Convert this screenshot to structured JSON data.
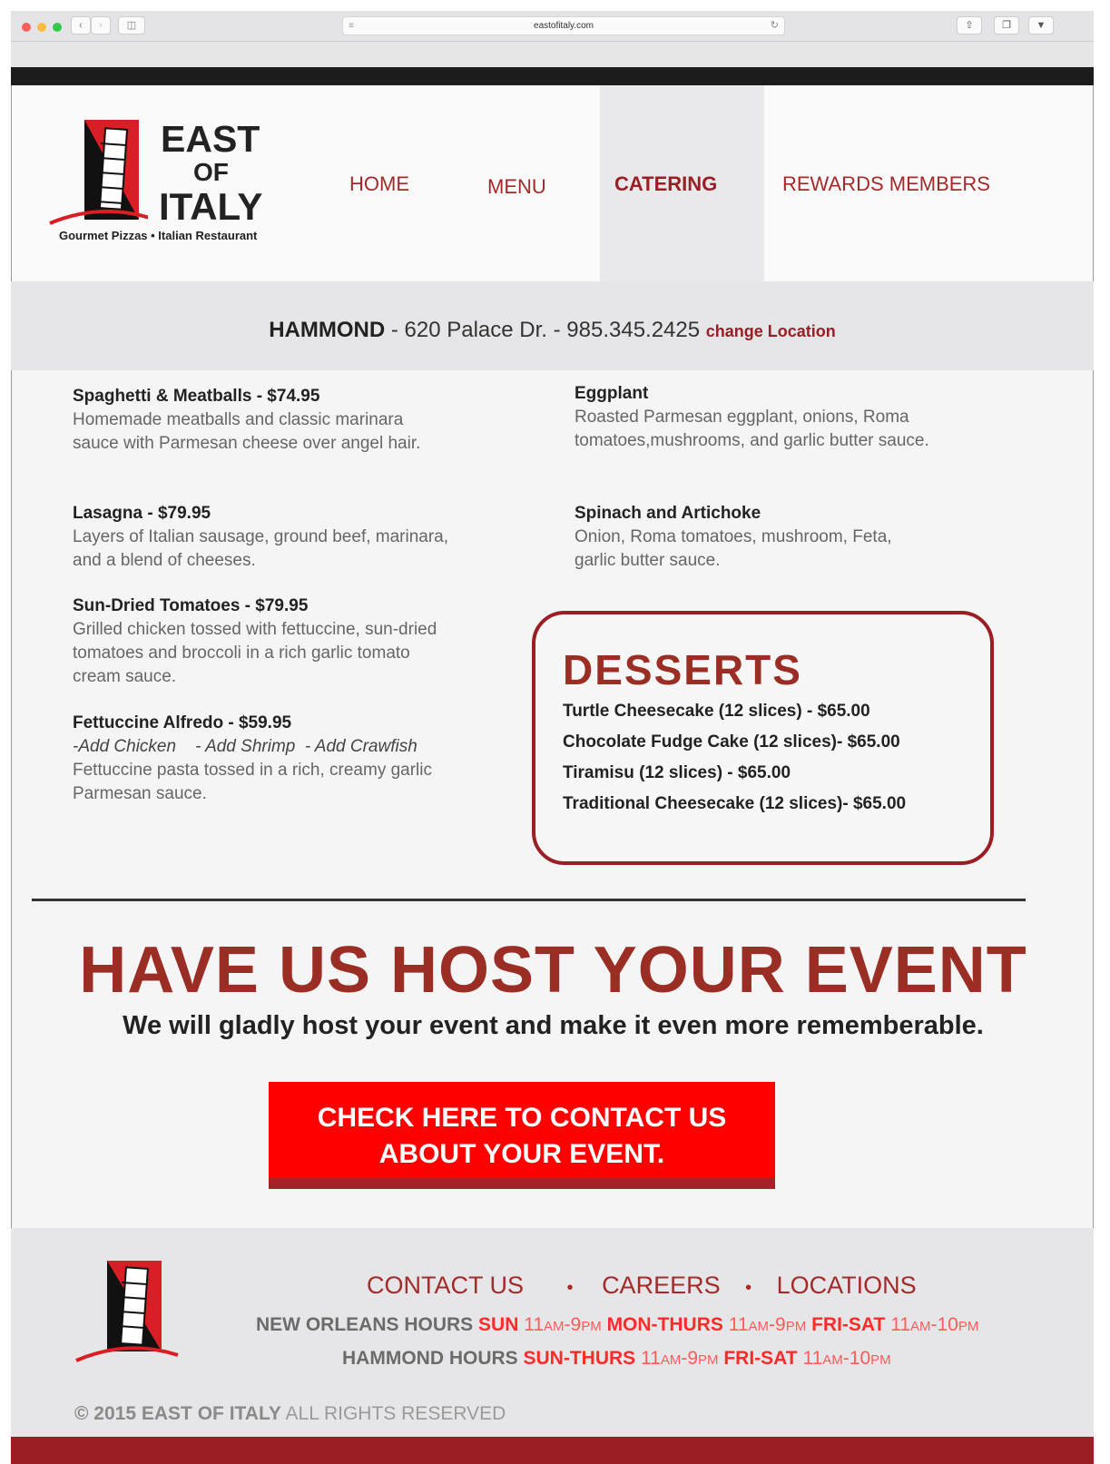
{
  "browser": {
    "url": "eastofitaly.com",
    "back_icon": "chevron-left-icon",
    "forward_icon": "chevron-right-icon"
  },
  "logo": {
    "line1": "EAST",
    "line2": "OF",
    "line3": "ITALY",
    "tagline": "Gourmet Pizzas • Italian Restaurant"
  },
  "nav": {
    "home": "HOME",
    "menu": "MENU",
    "catering": "CATERING",
    "rewards": "REWARDS MEMBERS"
  },
  "location": {
    "city": "HAMMOND",
    "sep1": " - ",
    "address": "620 Palace Dr.",
    "sep2": " - ",
    "phone": "985.345.2425",
    "change_label": "change Location"
  },
  "menu_left": [
    {
      "title": "Spaghetti & Meatballs - $74.95",
      "desc": "Homemade meatballs and classic marinara sauce with Parmesan cheese over angel hair."
    },
    {
      "title": "Lasagna - $79.95",
      "desc": "Layers of Italian sausage, ground beef, marinara, and a blend of cheeses."
    },
    {
      "title": "Sun-Dried Tomatoes - $79.95",
      "desc": "Grilled chicken tossed with fettuccine, sun-dried tomatoes and broccoli in a rich garlic tomato cream sauce."
    },
    {
      "title": "Fettuccine Alfredo - $59.95",
      "addons": "-Add Chicken    - Add Shrimp  - Add Crawfish",
      "desc": "Fettuccine pasta tossed in a rich, creamy garlic",
      "desc2": "Parmesan sauce."
    }
  ],
  "menu_right": [
    {
      "title": "Eggplant",
      "desc": "Roasted Parmesan eggplant, onions, Roma tomatoes,mushrooms, and garlic butter sauce."
    },
    {
      "title": "Spinach and Artichoke",
      "desc": "Onion, Roma tomatoes, mushroom, Feta, garlic butter sauce."
    }
  ],
  "desserts": {
    "heading": "DESSERTS",
    "items": [
      "Turtle Cheesecake  (12 slices) - $65.00",
      "Chocolate Fudge Cake (12 slices)- $65.00",
      "Tiramisu (12 slices) - $65.00",
      "Traditional Cheesecake  (12 slices)- $65.00"
    ]
  },
  "event": {
    "heading": "HAVE US HOST YOUR EVENT",
    "subheading": "We will gladly host your event  and make it even more rememberable.",
    "cta_line1": "CHECK HERE TO CONTACT US",
    "cta_line2": "ABOUT YOUR EVENT."
  },
  "footer": {
    "contact": "CONTACT US",
    "careers": "CAREERS",
    "locations": "LOCATIONS",
    "bullet": "•",
    "no_label": "NEW ORLEANS HOURS",
    "no_d1": "SUN",
    "no_d2": "MON-THURS",
    "no_d3": "FRI-SAT",
    "h_label": "HAMMOND HOURS",
    "h_d1": "SUN-THURS",
    "h_d2": "FRI-SAT",
    "t11": "11",
    "am": "AM",
    "dash": "-",
    "t9": "9",
    "t10": "10",
    "pm": "PM",
    "copyright_bold": "© 2015 EAST OF ITALY",
    "copyright_rest": " ALL RIGHTS RESERVED"
  },
  "colors": {
    "brand_red": "#9a1e24",
    "cta_red": "#ff0000",
    "heading_brown": "#9b2e24"
  }
}
